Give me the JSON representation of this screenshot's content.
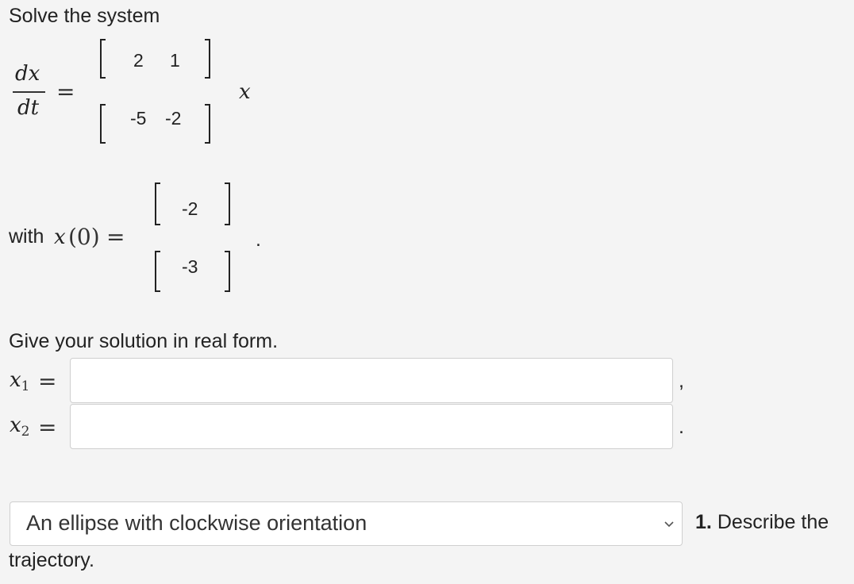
{
  "question": {
    "intro": "Solve the system",
    "lhs": {
      "numerator": "dx",
      "denominator": "dt",
      "equals": "="
    },
    "matrix": {
      "rows": [
        [
          "2",
          "1"
        ],
        [
          "-5",
          "-2"
        ]
      ]
    },
    "rhs_variable": "x",
    "initial_condition": {
      "prefix": "with",
      "func": "x",
      "arg": "(0)",
      "equals": "=",
      "vector": [
        "-2",
        "-3"
      ],
      "end_punct": "."
    },
    "instruction": "Give your solution in real form.",
    "answers": [
      {
        "var": "x",
        "sub": "1",
        "equals": "=",
        "value": "",
        "punct": ","
      },
      {
        "var": "x",
        "sub": "2",
        "equals": "=",
        "value": "",
        "punct": "."
      }
    ],
    "trajectory": {
      "selected": "An ellipse with clockwise orientation",
      "part_label": "1. Describe the",
      "part_label_cont": "trajectory."
    }
  }
}
